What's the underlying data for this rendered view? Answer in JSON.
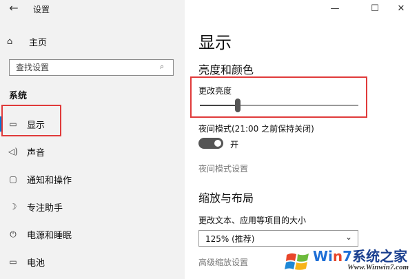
{
  "window": {
    "title": "设置",
    "back_icon": "←",
    "minimize": "—",
    "maximize": "☐",
    "close": "✕"
  },
  "sidebar": {
    "home": {
      "icon": "⌂",
      "label": "主页"
    },
    "search": {
      "placeholder": "查找设置",
      "icon": "⌕"
    },
    "section_title": "系统",
    "items": [
      {
        "name": "display",
        "icon": "▭",
        "label": "显示",
        "selected": true
      },
      {
        "name": "sound",
        "icon": "◁)",
        "label": "声音",
        "selected": false
      },
      {
        "name": "notifications",
        "icon": "▢",
        "label": "通知和操作",
        "selected": false
      },
      {
        "name": "focus-assist",
        "icon": "☽",
        "label": "专注助手",
        "selected": false
      },
      {
        "name": "power-sleep",
        "icon": "⏻",
        "label": "电源和睡眠",
        "selected": false
      },
      {
        "name": "battery",
        "icon": "▭",
        "label": "电池",
        "selected": false
      }
    ]
  },
  "main": {
    "title": "显示",
    "brightness_section": "亮度和颜色",
    "brightness_label": "更改亮度",
    "brightness_value": 0.24,
    "night_mode_label": "夜间模式(21:00 之前保持关闭)",
    "toggle_state": "开",
    "toggle_on": true,
    "night_mode_link": "夜间模式设置",
    "scale_section": "缩放与布局",
    "scale_label": "更改文本、应用等项目的大小",
    "scale_value": "125% (推荐)",
    "advanced_link": "高级缩放设置"
  },
  "watermark": {
    "brand_prefix": "Wi",
    "brand_n": "n",
    "brand_7": "7",
    "brand_suffix": "系统之家",
    "url": "Www.Winwin7.com"
  },
  "colors": {
    "accent": "#0078d7",
    "highlight_box": "#e03a3a",
    "sidebar_bg": "#f2f2f2",
    "link_gray": "#7a7a7a"
  }
}
